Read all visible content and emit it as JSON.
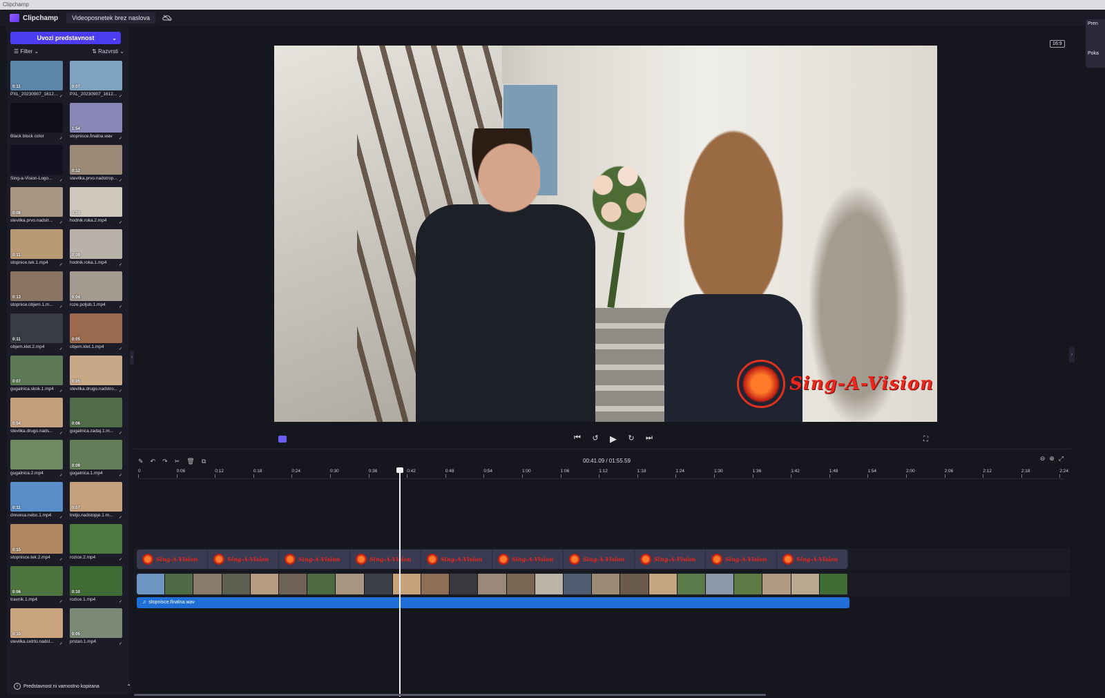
{
  "window": {
    "title": "Clipchamp"
  },
  "header": {
    "app_name": "Clipchamp",
    "project_title": "Videoposnetek brez naslova",
    "aspect_ratio": "16:9",
    "side_panel_top": "Pren",
    "side_panel_bottom": "Poka"
  },
  "sidebar": {
    "import_label": "Uvozi predstavnost",
    "filter_label": "Filter",
    "sort_label": "Razvrsti",
    "media": [
      {
        "label": "PXL_20230907_161205...",
        "dur": "0:11",
        "color": "#5b86a8"
      },
      {
        "label": "PXL_20230907_1612...",
        "dur": "0:07",
        "color": "#7ea3c1"
      },
      {
        "label": "Black block color",
        "dur": "",
        "color": "#0e0f18"
      },
      {
        "label": "stopnisce.finalna.wav",
        "dur": "1:54",
        "color": "#8a86b5"
      },
      {
        "label": "Sing-a-Vision-Logo...",
        "dur": "",
        "color": "#151020"
      },
      {
        "label": "stevilka.prvo.nadstropj...",
        "dur": "0:12",
        "color": "#9c8a78"
      },
      {
        "label": "stevilka.prvo.nadstr...",
        "dur": "0:08",
        "color": "#a89582"
      },
      {
        "label": "hodnik.roka.2.mp4",
        "dur": "0:10",
        "color": "#cfc8bd"
      },
      {
        "label": "stopnice.tek.1.mp4",
        "dur": "0:11",
        "color": "#b99a74"
      },
      {
        "label": "hodnik.roka.1.mp4",
        "dur": "0:09",
        "color": "#b8b2a8"
      },
      {
        "label": "stopnice.objem.1.m...",
        "dur": "0:13",
        "color": "#8b7462"
      },
      {
        "label": "roze.poljub.1.mp4",
        "dur": "0:04",
        "color": "#a49a90"
      },
      {
        "label": "objem.klet.2.mp4",
        "dur": "0:11",
        "color": "#3a3c45"
      },
      {
        "label": "objem.klet.1.mp4",
        "dur": "0:05",
        "color": "#9b6a4e"
      },
      {
        "label": "gugalnica.skok.1.mp4",
        "dur": "0:07",
        "color": "#5e7a55"
      },
      {
        "label": "stevilka.drugo.nadstro...",
        "dur": "0:05",
        "color": "#c8a886"
      },
      {
        "label": "stevilka.drugo.nads...",
        "dur": "0:04",
        "color": "#c49f7e"
      },
      {
        "label": "gugalnica.zadaj.1.m...",
        "dur": "0:06",
        "color": "#4f6b48"
      },
      {
        "label": "gugalnica.2.mp4",
        "dur": "",
        "color": "#6f8a62"
      },
      {
        "label": "gugalnica.1.mp4",
        "dur": "0:09",
        "color": "#627d57"
      },
      {
        "label": "drevesa.nebo.1.mp4",
        "dur": "0:11",
        "color": "#5a8ec8"
      },
      {
        "label": "tretjo.nadstopje.1.m...",
        "dur": "0:07",
        "color": "#c4a07c"
      },
      {
        "label": "stopnisce.tek.2.mp4",
        "dur": "0:15",
        "color": "#b08862"
      },
      {
        "label": "rozice.2.mp4",
        "dur": "",
        "color": "#4d7a3e"
      },
      {
        "label": "travnik.1.mp4",
        "dur": "0:06",
        "color": "#4e7540"
      },
      {
        "label": "rozice.1.mp4",
        "dur": "0:10",
        "color": "#3f6b34"
      },
      {
        "label": "stevilka.cetrto.nadst...",
        "dur": "0:10",
        "color": "#c9a47f"
      },
      {
        "label": "prstan.1.mp4",
        "dur": "0:05",
        "color": "#7b8a74"
      }
    ],
    "backup_label": "Predstavnost ni varnostno kopirana"
  },
  "preview": {
    "watermark_text": "Sing-A-Vision"
  },
  "timeline": {
    "timecode": "00:41.09 / 01:55.59",
    "ticks": [
      "0",
      "0:06",
      "0:12",
      "0:18",
      "0:24",
      "0:30",
      "0:36",
      "0:42",
      "0:48",
      "0:54",
      "1:00",
      "1:06",
      "1:12",
      "1:18",
      "1:24",
      "1:30",
      "1:36",
      "1:42",
      "1:48",
      "1:54",
      "2:00",
      "2:06",
      "2:12",
      "2:18",
      "2:24"
    ],
    "overlay_clip_text": "Sing-A-Vision",
    "video_clip_colors": [
      "#6d95c2",
      "#4f6b45",
      "#8a7a6a",
      "#5a5f50",
      "#b59b80",
      "#6e6256",
      "#4d6940",
      "#a89580",
      "#3b3f48",
      "#c7a37c",
      "#8e6e55",
      "#37393f",
      "#9a8878",
      "#7a6655",
      "#bcb4a8",
      "#4f5d70",
      "#9c8a74",
      "#6a5a4a",
      "#c6a583",
      "#5a7a4a",
      "#8b98a8",
      "#5d7a44",
      "#b39b82",
      "#bba98f",
      "#3f6b34"
    ],
    "audio_label": "stopnisce.finalna.wav"
  },
  "icons": {
    "play": "play-icon",
    "skip_back": "skip-back-icon",
    "rewind": "rewind-5-icon",
    "forward": "forward-5-icon",
    "skip_forward": "skip-forward-icon"
  }
}
